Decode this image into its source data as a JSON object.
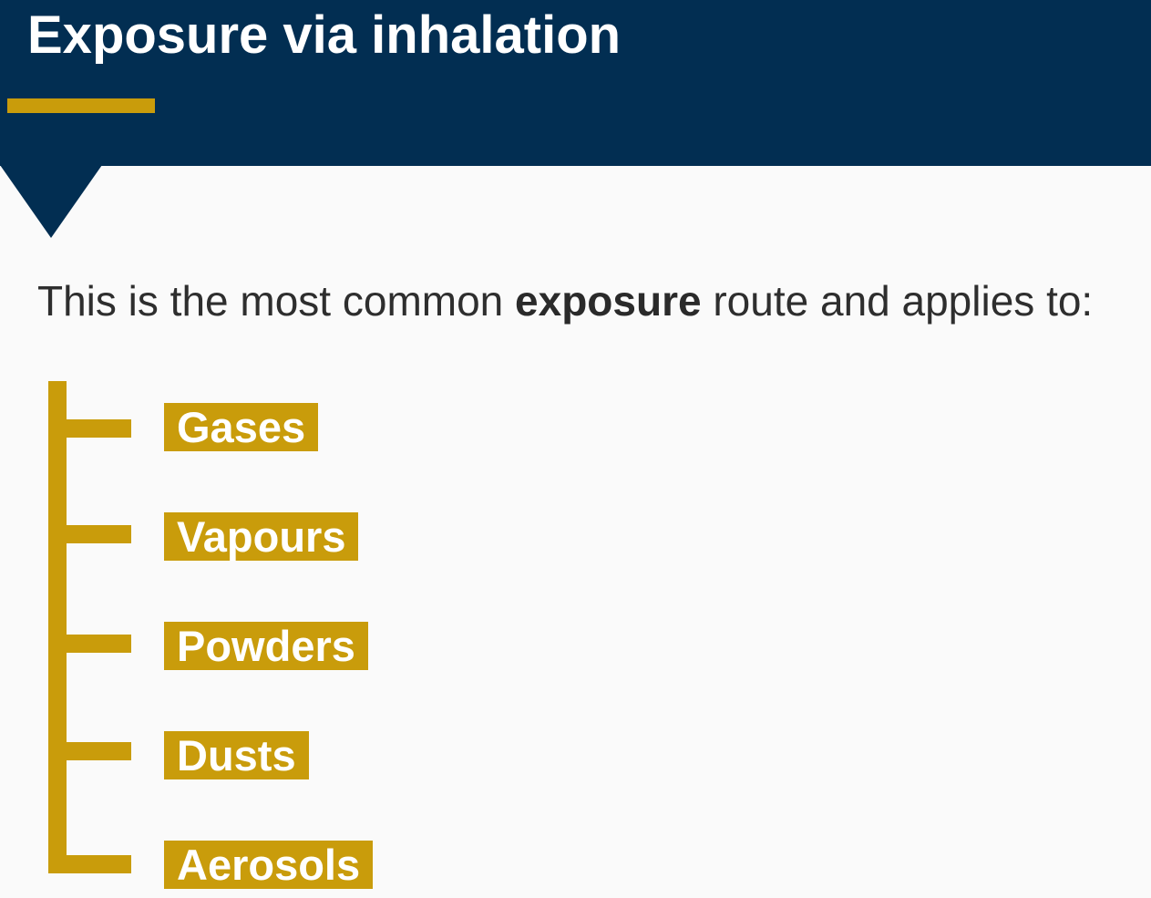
{
  "header": {
    "title": "Exposure via inhalation",
    "background_color": "#022e52",
    "accent_color": "#c99c0b"
  },
  "intro": {
    "before": "This is the most common ",
    "emphasis": "exposure",
    "after": " route and applies to:"
  },
  "items": [
    {
      "label": "Gases"
    },
    {
      "label": "Vapours"
    },
    {
      "label": "Powders"
    },
    {
      "label": "Dusts"
    },
    {
      "label": "Aerosols"
    }
  ]
}
